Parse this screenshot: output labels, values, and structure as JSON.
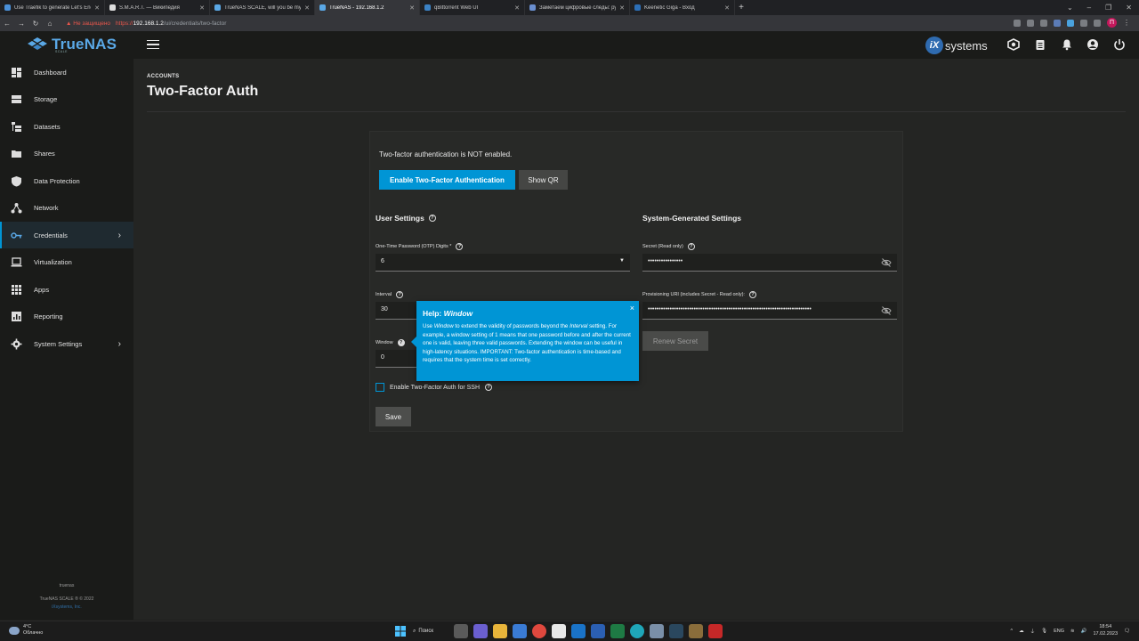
{
  "browser": {
    "tabs": [
      {
        "label": "Use Traefik to generate Let's Enc",
        "color": "#4a90d9"
      },
      {
        "label": "S.M.A.R.T. — Википедия",
        "color": "#dddddd"
      },
      {
        "label": "TrueNAS SCALE, will you be my",
        "color": "#5aa8e6"
      },
      {
        "label": "TrueNAS - 192.168.1.2",
        "color": "#5aa8e6",
        "active": true
      },
      {
        "label": "qBittorrent Web UI",
        "color": "#3b82c4"
      },
      {
        "label": "Заметаем цифровые следы: ру",
        "color": "#6a8fd0"
      },
      {
        "label": "Keenetic Giga - Вход",
        "color": "#2c6fb7"
      }
    ],
    "new_tab": "+",
    "security_warning": "Не защищено",
    "url_proto": "https://",
    "url_host": "192.168.1.2",
    "url_path": "/ui/credentials/two-factor",
    "profile_initial": "П"
  },
  "header": {
    "logo_text": "TrueNAS",
    "logo_sub": "SCALE",
    "vendor_mark": "iX",
    "vendor_text": "systems"
  },
  "sidebar": {
    "items": [
      {
        "label": "Dashboard",
        "icon": "dashboard-icon"
      },
      {
        "label": "Storage",
        "icon": "storage-icon"
      },
      {
        "label": "Datasets",
        "icon": "datasets-icon"
      },
      {
        "label": "Shares",
        "icon": "shares-icon"
      },
      {
        "label": "Data Protection",
        "icon": "shield-icon"
      },
      {
        "label": "Network",
        "icon": "network-icon"
      },
      {
        "label": "Credentials",
        "icon": "key-icon",
        "active": true,
        "chevron": "›"
      },
      {
        "label": "Virtualization",
        "icon": "laptop-icon"
      },
      {
        "label": "Apps",
        "icon": "apps-icon"
      },
      {
        "label": "Reporting",
        "icon": "chart-icon"
      },
      {
        "label": "System Settings",
        "icon": "gear-icon",
        "chevron": "›"
      }
    ],
    "footer_hostname": "truenas",
    "footer_version": "TrueNAS SCALE ® © 2022",
    "footer_vendor": "iXsystems, Inc."
  },
  "main": {
    "breadcrumb": "ACCOUNTS",
    "title": "Two-Factor Auth",
    "status_text": "Two-factor authentication is NOT enabled.",
    "enable_button": "Enable Two-Factor Authentication",
    "show_qr_button": "Show QR",
    "user_settings": {
      "title": "User Settings",
      "otp_label": "One-Time Password (OTP) Digits *",
      "otp_value": "6",
      "interval_label": "Interval",
      "interval_value": "30",
      "window_label": "Window",
      "window_value": "0",
      "ssh_label": "Enable Two-Factor Auth for SSH",
      "ssh_checked": false
    },
    "system_settings": {
      "title": "System-Generated Settings",
      "secret_label": "Secret (Read only)",
      "secret_value": "••••••••••••••••",
      "uri_label": "Provisioning URI (includes Secret - Read only):",
      "uri_value": "•••••••••••••••••••••••••••••••••••••••••••••••••••••••••••••••••••••••••••",
      "renew_button": "Renew Secret"
    },
    "save_button": "Save"
  },
  "tooltip": {
    "title_prefix": "Help: ",
    "title_term": "Window",
    "body_pre": "Use ",
    "body_term": "Window",
    "body_mid": " to extend the validity of passwords beyond the ",
    "body_term2": "Interval",
    "body_rest": " setting. For example, a window setting of 1 means that one password before and after the current one is valid, leaving three valid passwords. Extending the window can be useful in high-latency situations. IMPORTANT: Two-factor authentication is time-based and requires that the system time is set correctly.",
    "close": "×"
  },
  "taskbar": {
    "temp": "4°C",
    "weather": "Облачно",
    "search": "Поиск",
    "lang": "ENG",
    "time": "18:54",
    "date": "17.02.2023"
  },
  "colors": {
    "accent": "#0095d5",
    "background": "#242523",
    "sidebar": "#1a1b19"
  }
}
